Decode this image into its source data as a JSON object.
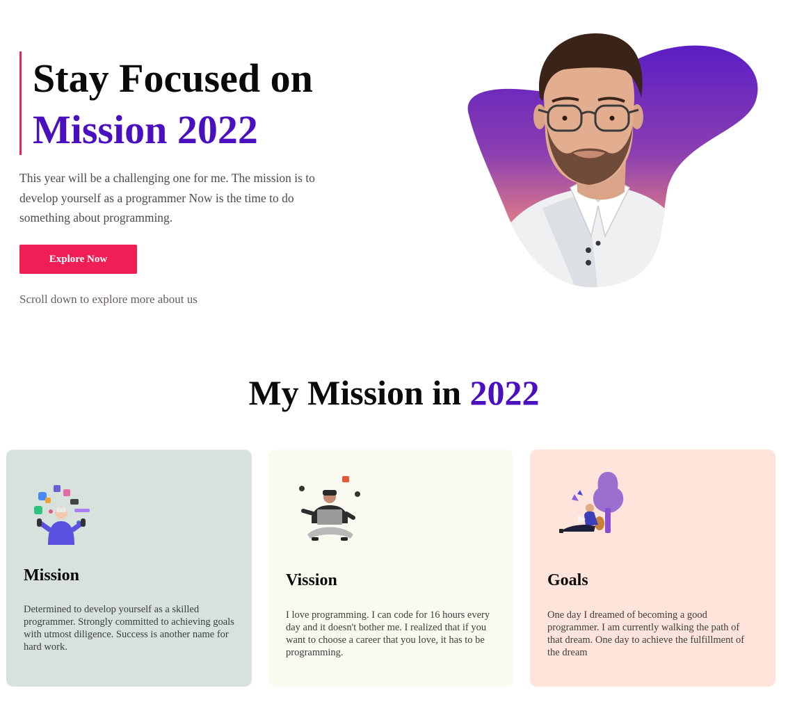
{
  "hero": {
    "title_line1": "Stay Focused on",
    "title_line2": "Mission 2022",
    "description": "This year will be a challenging one for me. The mission is to develop yourself as a programmer Now is the time to do something about programming.",
    "cta_label": "Explore Now",
    "scroll_hint": "Scroll down to explore more about us",
    "portrait_icon": "portrait-photo-icon"
  },
  "mission_section": {
    "title_prefix": "My Mission in ",
    "title_accent": "2022"
  },
  "cards": [
    {
      "heading": "Mission",
      "text": "Determined to develop yourself as a skilled programmer. Strongly committed to achieving goals with utmost diligence. Success is another name for hard work.",
      "icon": "juggling-apps-person-icon",
      "background": "#d7e2dc"
    },
    {
      "heading": "Vission",
      "text": "I love programming. I can code for 16 hours every day and it doesn't bother me. I realized that if you want to choose a career that you love, it has to be programming.",
      "icon": "coder-with-laptop-icon",
      "background": "#fbfaf0"
    },
    {
      "heading": "Goals",
      "text": "One day I dreamed of becoming a good programmer. I am currently walking the path of that dream. One day to achieve the fulfillment of the dream",
      "icon": "person-reading-under-tree-icon",
      "background": "#fee4da"
    }
  ],
  "colors": {
    "accent": "#4a0fbf",
    "button": "#ef1f55",
    "border_accent": "#e0285a"
  }
}
